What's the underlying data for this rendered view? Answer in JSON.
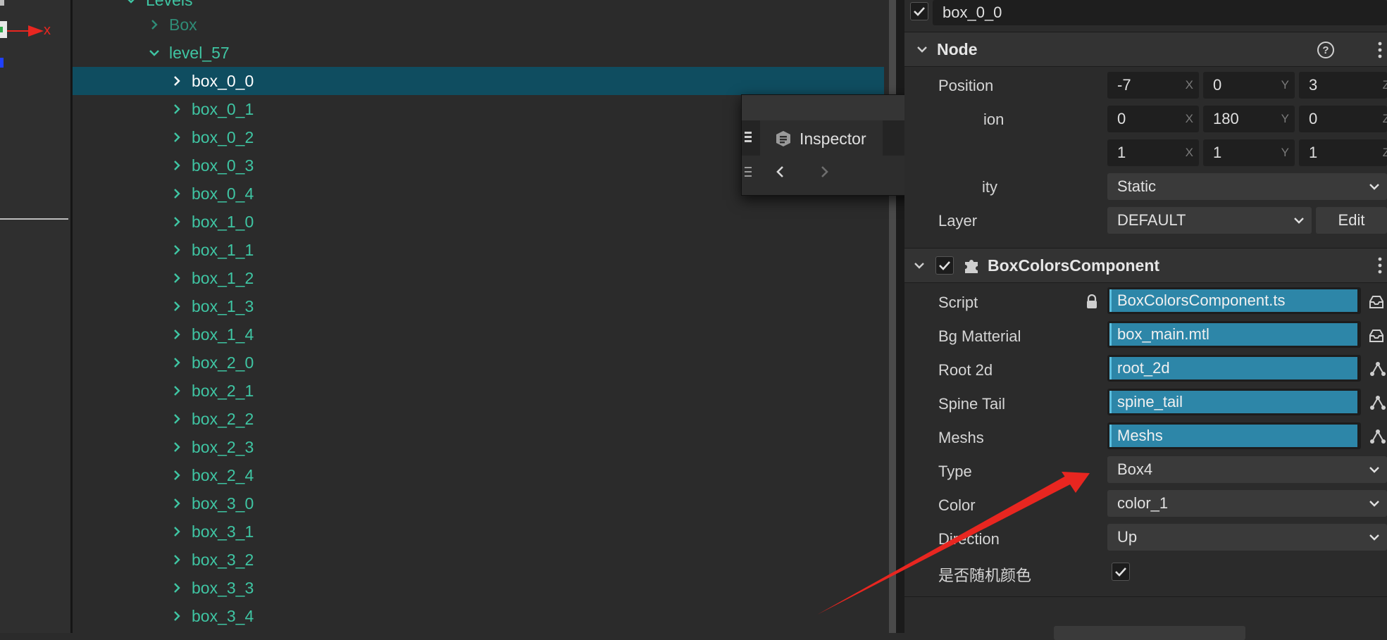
{
  "colors": {
    "accent_selected_row": "#0f4d60",
    "tree_text": "#3fc5a3",
    "asset_bar": "#2d86a8",
    "annotation_arrow": "#e82620"
  },
  "scene": {
    "axis_label": "x"
  },
  "hierarchy": {
    "items": [
      {
        "label": "Levels",
        "expanded": true,
        "depth": 0
      },
      {
        "label": "Box",
        "expanded": false,
        "depth": 1
      },
      {
        "label": "level_57",
        "expanded": true,
        "depth": 1
      },
      {
        "label": "box_0_0",
        "expanded": false,
        "depth": 2,
        "selected": true
      },
      {
        "label": "box_0_1",
        "depth": 2
      },
      {
        "label": "box_0_2",
        "depth": 2
      },
      {
        "label": "box_0_3",
        "depth": 2
      },
      {
        "label": "box_0_4",
        "depth": 2
      },
      {
        "label": "box_1_0",
        "depth": 2
      },
      {
        "label": "box_1_1",
        "depth": 2
      },
      {
        "label": "box_1_2",
        "depth": 2
      },
      {
        "label": "box_1_3",
        "depth": 2
      },
      {
        "label": "box_1_4",
        "depth": 2
      },
      {
        "label": "box_2_0",
        "depth": 2
      },
      {
        "label": "box_2_1",
        "depth": 2
      },
      {
        "label": "box_2_2",
        "depth": 2
      },
      {
        "label": "box_2_3",
        "depth": 2
      },
      {
        "label": "box_2_4",
        "depth": 2
      },
      {
        "label": "box_3_0",
        "depth": 2
      },
      {
        "label": "box_3_1",
        "depth": 2
      },
      {
        "label": "box_3_2",
        "depth": 2
      },
      {
        "label": "box_3_3",
        "depth": 2
      },
      {
        "label": "box_3_4",
        "depth": 2
      }
    ]
  },
  "floating_tab": {
    "label": "Inspector",
    "icon": "inspector-icon",
    "nav_back": "chevron-left-icon",
    "nav_forward": "chevron-right-icon"
  },
  "inspector": {
    "node_name": "box_0_0",
    "node_section": {
      "title": "Node",
      "position": {
        "label": "Position",
        "x": "-7",
        "y": "0",
        "z": "3"
      },
      "rotation": {
        "label_visible": "ion",
        "x": "0",
        "y": "180",
        "z": "0"
      },
      "scale": {
        "x": "1",
        "y": "1",
        "z": "1"
      },
      "mobility": {
        "label_visible": "ity",
        "value": "Static"
      },
      "layer": {
        "label": "Layer",
        "value": "DEFAULT",
        "edit_label": "Edit"
      },
      "axis_x": "X",
      "axis_y": "Y",
      "axis_z": "Z"
    },
    "component": {
      "title": "BoxColorsComponent",
      "props": {
        "script": {
          "label": "Script",
          "value": "BoxColorsComponent.ts"
        },
        "bg": {
          "label": "Bg Matterial",
          "value": "box_main.mtl"
        },
        "root2d": {
          "label": "Root 2d",
          "value": "root_2d"
        },
        "spine": {
          "label": "Spine Tail",
          "value": "spine_tail"
        },
        "meshs": {
          "label": "Meshs",
          "value": "Meshs"
        },
        "type": {
          "label": "Type",
          "value": "Box4"
        },
        "color": {
          "label": "Color",
          "value": "color_1"
        },
        "direction": {
          "label": "Direction",
          "value": "Up"
        },
        "random": {
          "label": "是否随机颜色",
          "checked": true
        }
      }
    }
  }
}
